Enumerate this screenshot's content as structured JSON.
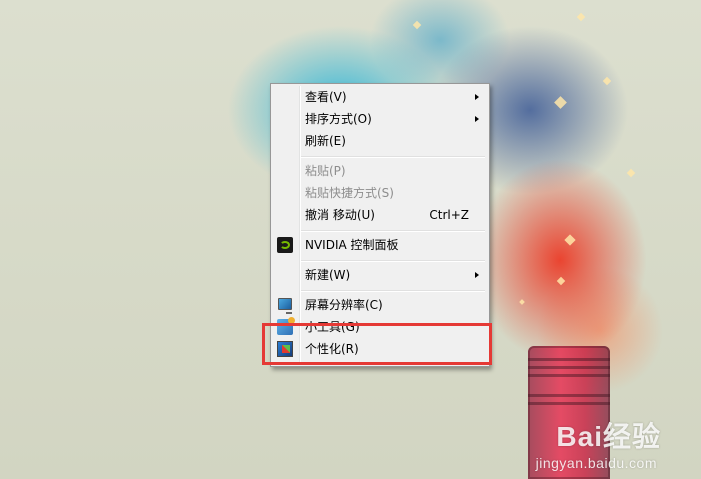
{
  "desktop": {
    "watermark": {
      "brand": "Bai经验",
      "sub": "jingyan.baidu.com"
    }
  },
  "context_menu": {
    "items": [
      {
        "label": "查看(V)",
        "submenu": true
      },
      {
        "label": "排序方式(O)",
        "submenu": true
      },
      {
        "label": "刷新(E)"
      },
      {
        "label": "粘贴(P)",
        "disabled": true
      },
      {
        "label": "粘贴快捷方式(S)",
        "disabled": true
      },
      {
        "label": "撤消 移动(U)",
        "shortcut": "Ctrl+Z"
      },
      {
        "label": "NVIDIA 控制面板",
        "icon": "nvidia-icon"
      },
      {
        "label": "新建(W)",
        "submenu": true
      },
      {
        "label": "屏幕分辨率(C)",
        "icon": "display-resolution-icon"
      },
      {
        "label": "小工具(G)",
        "icon": "gadgets-icon"
      },
      {
        "label": "个性化(R)",
        "icon": "personalize-icon"
      }
    ]
  },
  "annotation": {
    "color": "#e53935"
  }
}
